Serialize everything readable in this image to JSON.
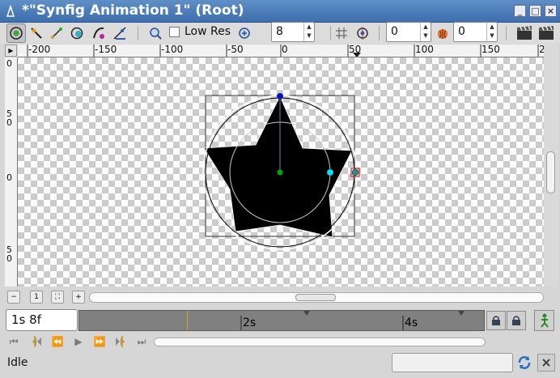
{
  "window": {
    "title": "*\"Synfig Animation 1\" (Root)",
    "controls": [
      "minimize-icon",
      "maximize-icon",
      "close-icon"
    ]
  },
  "toolbar": {
    "low_res_label": "Low Res",
    "low_res_checked": false,
    "quality_value": "8",
    "onion_past_value": "0",
    "onion_future_value": "0",
    "tools": [
      "transform-tool-icon",
      "smooth-move-tool-icon",
      "scale-tool-icon",
      "rotate-tool-icon",
      "mirror-tool-icon",
      "draw-tool-icon"
    ]
  },
  "ruler": {
    "horizontal_ticks": [
      "-200",
      "-150",
      "-100",
      "-50",
      "0",
      "50",
      "100",
      "150",
      "2"
    ],
    "vertical_ticks": [
      "0",
      "5",
      "0",
      "0",
      "5",
      "0"
    ]
  },
  "canvas": {
    "shape": "star",
    "star_color": "#000000",
    "handle_colors": {
      "origin": "#00aa00",
      "radius": "#00e5ff",
      "angle": "#1010c0",
      "selected": "#e02020"
    }
  },
  "timebar": {
    "current_time": "1s 8f",
    "marks": [
      "2s",
      "4s"
    ]
  },
  "status": {
    "text": "Idle"
  }
}
